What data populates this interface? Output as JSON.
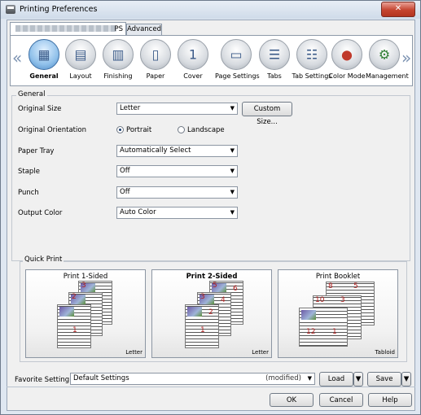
{
  "window": {
    "title": "Printing Preferences",
    "close_glyph": "✕"
  },
  "tabs": [
    {
      "label": "PS"
    },
    {
      "label": "Advanced"
    }
  ],
  "categories": [
    {
      "label": "General",
      "icon": "general-icon",
      "selected": true
    },
    {
      "label": "Layout",
      "icon": "layout-icon"
    },
    {
      "label": "Finishing",
      "icon": "finishing-icon"
    },
    {
      "label": "Paper",
      "icon": "paper-icon"
    },
    {
      "label": "Cover",
      "icon": "cover-icon"
    },
    {
      "label": "Page Settings",
      "icon": "page-settings-icon"
    },
    {
      "label": "Tabs",
      "icon": "tabs-icon"
    },
    {
      "label": "Tab Settings",
      "icon": "tab-settings-icon"
    },
    {
      "label": "Color Mode",
      "icon": "color-mode-icon"
    },
    {
      "label": "Management",
      "icon": "management-icon"
    }
  ],
  "nav": {
    "prev": "«",
    "next": "»"
  },
  "general": {
    "group_title": "General",
    "original_size_label": "Original Size",
    "original_size_value": "Letter",
    "custom_size_button": "Custom Size...",
    "orientation_label": "Original Orientation",
    "portrait": "Portrait",
    "landscape": "Landscape",
    "paper_tray_label": "Paper Tray",
    "paper_tray_value": "Automatically Select",
    "staple_label": "Staple",
    "staple_value": "Off",
    "punch_label": "Punch",
    "punch_value": "Off",
    "output_color_label": "Output Color",
    "output_color_value": "Auto Color"
  },
  "quick_print": {
    "title": "Quick Print",
    "options": [
      {
        "title": "Print 1-Sided",
        "size": "Letter",
        "pages": [
          "1",
          "2",
          "3"
        ],
        "bold": false
      },
      {
        "title": "Print 2-Sided",
        "size": "Letter",
        "pages": [
          "1",
          "2",
          "3",
          "4",
          "5",
          "6"
        ],
        "bold": true
      },
      {
        "title": "Print Booklet",
        "size": "Tabloid",
        "pages": [
          "12",
          "1",
          "10",
          "3",
          "8",
          "5"
        ],
        "bold": false
      }
    ]
  },
  "favorite": {
    "label": "Favorite Setting",
    "value": "Default Settings",
    "modified": "(modified)",
    "load": "Load",
    "save": "Save"
  },
  "footer": {
    "ok": "OK",
    "cancel": "Cancel",
    "help": "Help"
  }
}
